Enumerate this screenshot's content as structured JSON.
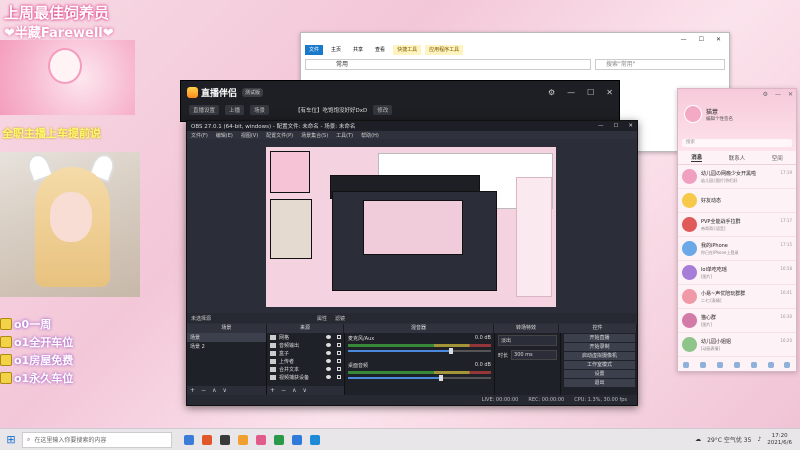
{
  "overlay": {
    "title": "上周最佳饲养员",
    "name_line": "❤半藏Farewell❤",
    "yellow_text": "全职主播上车提前说",
    "gifts": [
      {
        "label": "o0一周"
      },
      {
        "label": "o1全开车位"
      },
      {
        "label": "o1房屋免费"
      },
      {
        "label": "o1永久车位"
      }
    ]
  },
  "explorer": {
    "ribbon_tabs": [
      "文件",
      "主页",
      "共享",
      "查看",
      "快捷工具",
      "应用程序工具"
    ],
    "address": "常用",
    "search_placeholder": "搜索\"常用\"",
    "controls": [
      "—",
      "☐",
      "✕"
    ]
  },
  "zhibo": {
    "app_name": "直播伴侣",
    "version_badge": "测试版",
    "stream_title": "【有车位】吃饱饱没好好DxD",
    "stream_badge": "修改",
    "pills": [
      "直播设置",
      "上播",
      "场景"
    ],
    "controls": [
      "⚙",
      "—",
      "☐",
      "✕"
    ]
  },
  "obs": {
    "title": "OBS 27.0.1 (64-bit, windows) - 配置文件: 未命名 - 场景: 未命名",
    "controls": [
      "—",
      "☐",
      "✕"
    ],
    "menu": [
      "文件(F)",
      "编辑(E)",
      "视图(V)",
      "配置文件(P)",
      "场景集合(S)",
      "工具(T)",
      "帮助(H)"
    ],
    "scene_bar_label": "未选择源",
    "scene_bar_tools": [
      "属性",
      "滤镜"
    ],
    "dock_heads": [
      "场景",
      "来源",
      "混音器",
      "转场特效",
      "控件"
    ],
    "scenes": [
      "场景",
      "场景 2"
    ],
    "sources": [
      "网格",
      "音频输出",
      "盒子",
      "上传者",
      "合并文本",
      "视频捕获设备"
    ],
    "mixer": [
      {
        "name": "麦克风/Aux",
        "db": "0.0 dB",
        "level": 0.72
      },
      {
        "name": "桌面音频",
        "db": "0.0 dB",
        "level": 0.65
      }
    ],
    "transition": {
      "type": "淡出",
      "duration_label": "时长",
      "duration": "300 ms"
    },
    "controls_buttons": [
      "开始直播",
      "开始录制",
      "启动虚拟摄像机",
      "工作室模式",
      "设置",
      "退出"
    ],
    "status": [
      "LIVE: 00:00:00",
      "REC: 00:00:00",
      "CPU: 1.3%, 30.00 fps"
    ],
    "panel_foot": [
      "+",
      "−",
      "∧",
      "∨"
    ]
  },
  "qq": {
    "nickname": "猫薏",
    "signature": "编辑个性签名",
    "search_placeholder": "搜索",
    "controls": [
      "⚙",
      "—",
      "✕"
    ],
    "tabs": [
      "消息",
      "联系人",
      "空间"
    ],
    "items": [
      {
        "title": "幼儿园の网瘾少女开黑啦",
        "preview": "幼儿园:[图片]你们好",
        "time": "17:19",
        "color": "#f0a0c0"
      },
      {
        "title": "好友动态",
        "preview": "",
        "time": "",
        "color": "#f7c948"
      },
      {
        "title": "PVP全能战手拉群",
        "preview": "帝哥哥:[语音]",
        "time": "17:17",
        "color": "#e05a5a"
      },
      {
        "title": "我的iPhone",
        "preview": "你已在iPhone上登录",
        "time": "17:15",
        "color": "#6aa8e8"
      },
      {
        "title": "lol单吃吃瑶",
        "preview": "[图片]",
        "time": "16:58",
        "color": "#a77bd8"
      },
      {
        "title": "小易~声优陪玩群群",
        "preview": "二七:[表情]",
        "time": "16:41",
        "color": "#f09aa8"
      },
      {
        "title": "猫心群",
        "preview": "[图片]",
        "time": "16:30",
        "color": "#d47aa8"
      },
      {
        "title": "幼儿园小姐姐",
        "preview": "[动画表情]",
        "time": "16:20",
        "color": "#8fc48a"
      }
    ]
  },
  "taskbar": {
    "start_icon": "⊞",
    "search_placeholder": "在这里输入你要搜索的内容",
    "weather": "29°C 空气优 35",
    "time": "17:20",
    "date": "2021/6/6",
    "apps": [
      "#3b7dd8",
      "#e0572a",
      "#3a3a3a",
      "#f0a030",
      "#e05a8a",
      "#2a9a4a",
      "#2f7bd8",
      "#1e8bd8"
    ]
  }
}
